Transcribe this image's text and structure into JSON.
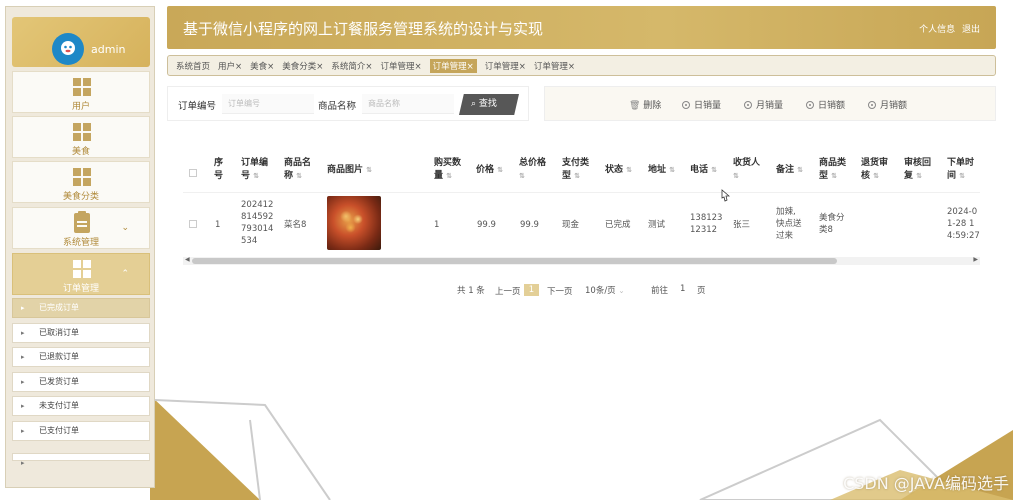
{
  "header": {
    "title": "基于微信小程序的网上订餐服务管理系统的设计与实现",
    "profile_link": "个人信息",
    "logout_link": "退出"
  },
  "sidebar": {
    "username": "admin",
    "menu": [
      {
        "label": "用户"
      },
      {
        "label": "美食"
      },
      {
        "label": "美食分类"
      },
      {
        "label": "系统管理",
        "chevron": "⌄"
      },
      {
        "label": "订单管理",
        "chevron": "⌃"
      }
    ],
    "sub_items": [
      {
        "label": "已完成订单"
      },
      {
        "label": "已取消订单"
      },
      {
        "label": "已退款订单"
      },
      {
        "label": "已发货订单"
      },
      {
        "label": "未支付订单"
      },
      {
        "label": "已支付订单"
      }
    ]
  },
  "tabs": [
    {
      "label": "系统首页"
    },
    {
      "label": "用户×"
    },
    {
      "label": "美食×"
    },
    {
      "label": "美食分类×"
    },
    {
      "label": "系统简介×"
    },
    {
      "label": "订单管理×"
    },
    {
      "label": "订单管理×"
    },
    {
      "label": "订单管理×"
    },
    {
      "label": "订单管理×"
    }
  ],
  "search": {
    "order_no_label": "订单编号",
    "order_no_placeholder": "订单编号",
    "product_label": "商品名称",
    "product_placeholder": "商品名称",
    "search_button": "查找"
  },
  "actions": {
    "delete": "删除",
    "daily_sales": "日销量",
    "monthly_sales": "月销量",
    "daily_revenue": "日销额",
    "monthly_revenue": "月销额"
  },
  "table": {
    "headers": {
      "seq": [
        "序",
        "号"
      ],
      "order_no": [
        "订单编",
        "号"
      ],
      "product_name": [
        "商品名",
        "称"
      ],
      "product_image": "商品图片",
      "quantity": [
        "购买数",
        "量"
      ],
      "price": "价格",
      "total": [
        "总价格",
        ""
      ],
      "pay_type": [
        "支付类",
        "型"
      ],
      "status": "状态",
      "address": "地址",
      "phone": "电话",
      "receiver": "收货人",
      "remark": "备注",
      "category": [
        "商品类",
        "型"
      ],
      "refund_review": [
        "退货审",
        "核"
      ],
      "review_reply": [
        "审核回",
        "复"
      ],
      "order_time": [
        "下单时",
        "间"
      ]
    },
    "rows": [
      {
        "seq": "1",
        "order_no": [
          "202412",
          "814592",
          "793014",
          "534"
        ],
        "product_name": "菜名8",
        "quantity": "1",
        "price": "99.9",
        "total": "99.9",
        "pay_type": "现金",
        "status": "已完成",
        "address": "测试",
        "phone": [
          "138123",
          "12312"
        ],
        "receiver": "张三",
        "remark": [
          "加辣,",
          "快点送",
          "过来"
        ],
        "category": [
          "美食分",
          "类8"
        ],
        "refund_review": "",
        "review_reply": "",
        "order_time": [
          "2024-0",
          "1-28 1",
          "4:59:27"
        ]
      }
    ]
  },
  "pagination": {
    "total": "共 1 条",
    "prev": "上一页",
    "current": "1",
    "next": "下一页",
    "page_size": "10条/页",
    "goto_label": "前往",
    "goto_value": "1",
    "page_suffix": "页"
  },
  "watermark": "CSDN @JAVA编码选手",
  "colors": {
    "accent": "#c9a858",
    "accent_light": "#e3cf97",
    "search_button": "#575757"
  }
}
